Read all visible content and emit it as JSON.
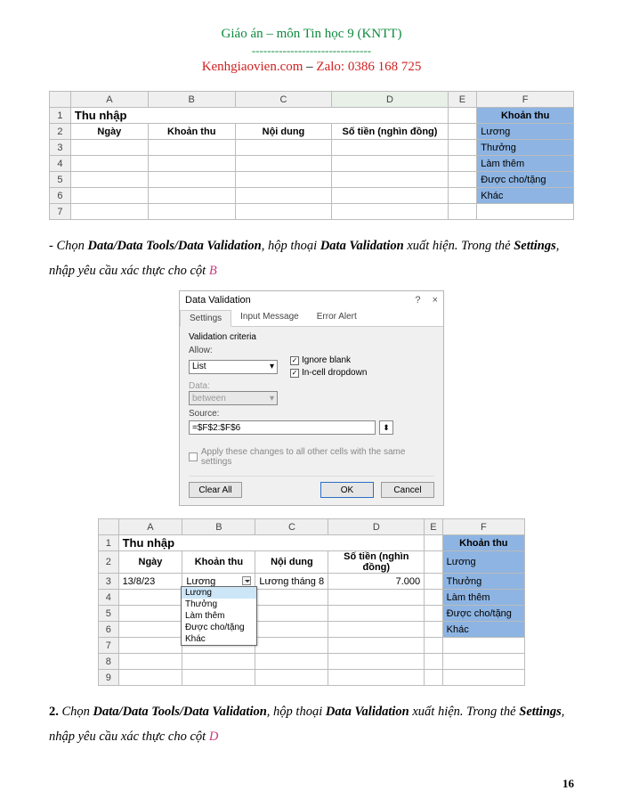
{
  "header": {
    "title": "Giáo án – môn Tin học 9 (KNTT)",
    "dashes": "-------------------------------",
    "site": "Kenhgiaovien.com",
    "sep": " – ",
    "zalo_label": "Zalo: ",
    "zalo_num": "0386 168 725"
  },
  "spreadsheet1": {
    "cols": [
      "A",
      "B",
      "C",
      "D",
      "E",
      "F"
    ],
    "rows": [
      "1",
      "2",
      "3",
      "4",
      "5",
      "6",
      "7"
    ],
    "title": "Thu nhập",
    "headers": {
      "A": "Ngày",
      "B": "Khoản thu",
      "C": "Nội dung",
      "D": "Số tiền (nghìn đồng)",
      "F": "Khoản thu"
    },
    "f_items": [
      "Lương",
      "Thưởng",
      "Làm thêm",
      "Được cho/tặng",
      "Khác"
    ]
  },
  "para1": {
    "t1": "- Chọn ",
    "b1": "Data/Data Tools/Data Validation",
    "t2": ", hộp thoại ",
    "b2": "Data Validation",
    "t3": " xuất hiện. Trong thẻ ",
    "b3": "Settings",
    "t4": ", nhập yêu cầu xác thực cho cột ",
    "col": "B"
  },
  "dialog": {
    "title": "Data Validation",
    "help": "?",
    "close": "×",
    "tabs": [
      "Settings",
      "Input Message",
      "Error Alert"
    ],
    "criteria_label": "Validation criteria",
    "allow_label": "Allow:",
    "allow_value": "List",
    "ignore_blank": "Ignore blank",
    "incell": "In-cell dropdown",
    "data_label": "Data:",
    "data_value": "between",
    "source_label": "Source:",
    "source_value": "=$F$2:$F$6",
    "apply_label": "Apply these changes to all other cells with the same settings",
    "clear": "Clear All",
    "ok": "OK",
    "cancel": "Cancel"
  },
  "spreadsheet2": {
    "cols": [
      "A",
      "B",
      "C",
      "D",
      "E",
      "F"
    ],
    "rows": [
      "1",
      "2",
      "3",
      "4",
      "5",
      "6",
      "7",
      "8",
      "9"
    ],
    "title": "Thu nhập",
    "headers": {
      "A": "Ngày",
      "B": "Khoản thu",
      "C": "Nội dung",
      "D": "Số tiền (nghìn đồng)",
      "F": "Khoản thu"
    },
    "row3": {
      "A": "13/8/23",
      "B": "Lương",
      "C": "Lương tháng 8",
      "D": "7.000"
    },
    "f_items": [
      "Lương",
      "Thưởng",
      "Làm thêm",
      "Được cho/tặng",
      "Khác"
    ],
    "dropdown_items": [
      "Lương",
      "Thưởng",
      "Làm thêm",
      "Được cho/tặng",
      "Khác"
    ]
  },
  "para2": {
    "num": "2.",
    "t1": " Chọn ",
    "b1": "Data/Data Tools/Data Validation",
    "t2": ", hộp thoại ",
    "b2": "Data Validation",
    "t3": " xuất hiện. Trong thẻ ",
    "b3": "Settings",
    "t4": ", nhập yêu cầu xác thực cho cột ",
    "col": "D"
  },
  "page_number": "16"
}
